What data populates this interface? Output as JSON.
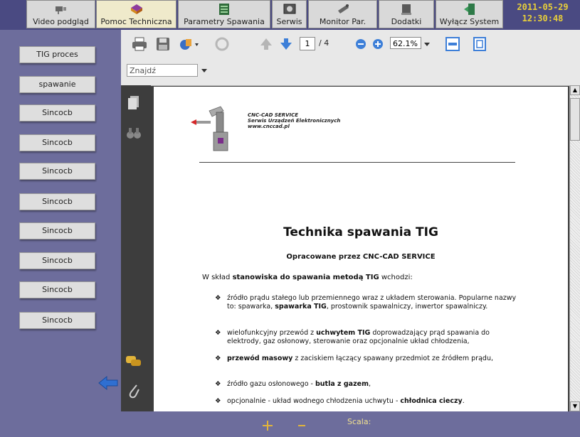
{
  "tabs": [
    {
      "label": "Video podgląd",
      "icon": "camera-icon"
    },
    {
      "label": "Pomoc Techniczna",
      "icon": "book-icon"
    },
    {
      "label": "Parametry Spawania",
      "icon": "parameters-icon"
    },
    {
      "label": "Serwis",
      "icon": "service-icon"
    },
    {
      "label": "Monitor Par.",
      "icon": "monitor-icon"
    },
    {
      "label": "Dodatki",
      "icon": "addons-icon"
    },
    {
      "label": "Wyłącz System",
      "icon": "exit-icon"
    }
  ],
  "clock": {
    "date": "2011-05-29",
    "time": "12:30:48"
  },
  "sidebar": {
    "items": [
      {
        "label": "TIG proces"
      },
      {
        "label": "spawanie"
      },
      {
        "label": "Sincocb"
      },
      {
        "label": "Sincocb"
      },
      {
        "label": "Sincocb"
      },
      {
        "label": "Sincocb"
      },
      {
        "label": "Sincocb"
      },
      {
        "label": "Sincocb"
      },
      {
        "label": "Sincocb"
      },
      {
        "label": "Sincocb"
      }
    ]
  },
  "viewer": {
    "page_current": "1",
    "page_total": "/ 4",
    "zoom": "62.1%",
    "find_placeholder": "Znajdź"
  },
  "document": {
    "company_line1": "CNC-CAD SERVICE",
    "company_line2": "Serwis Urządzeń Elektronicznych",
    "company_line3": "www.cnccad.pl",
    "title": "Technika spawania TIG",
    "subtitle": "Opracowane przez CNC-CAD SERVICE",
    "intro_plain1": "W skład ",
    "intro_bold": "stanowiska do spawania metodą TIG",
    "intro_plain2": " wchodzi:",
    "bullets": [
      {
        "pre": "źródło prądu stałego lub przemiennego wraz z układem sterowania. Popularne nazwy to: spawarka, ",
        "bold": "spawarka TIG",
        "post": ", prostownik spawalniczy, inwertor spawalniczy."
      },
      {
        "pre": "wielofunkcyjny przewód z ",
        "bold": "uchwytem TIG",
        "post": " doprowadzający prąd spawania do elektrody, gaz osłonowy, sterowanie oraz opcjonalnie układ chłodzenia,"
      },
      {
        "pre": "",
        "bold": "przewód masowy",
        "post": " z zaciskiem łączący spawany przedmiot ze źródłem prądu,"
      },
      {
        "pre": "źródło gazu osłonowego - ",
        "bold": "butla z gazem",
        "post": ","
      },
      {
        "pre": "opcjonalnie - układ wodnego chłodzenia uchwytu - ",
        "bold": "chłodnica cieczy",
        "post": "."
      }
    ]
  },
  "bottom": {
    "scala_label": "Scala:"
  },
  "colors": {
    "frame": "#6d6d9c",
    "topbar": "#4a4a82",
    "clock_text": "#e8cf3a",
    "active_tab": "#efeacb"
  }
}
